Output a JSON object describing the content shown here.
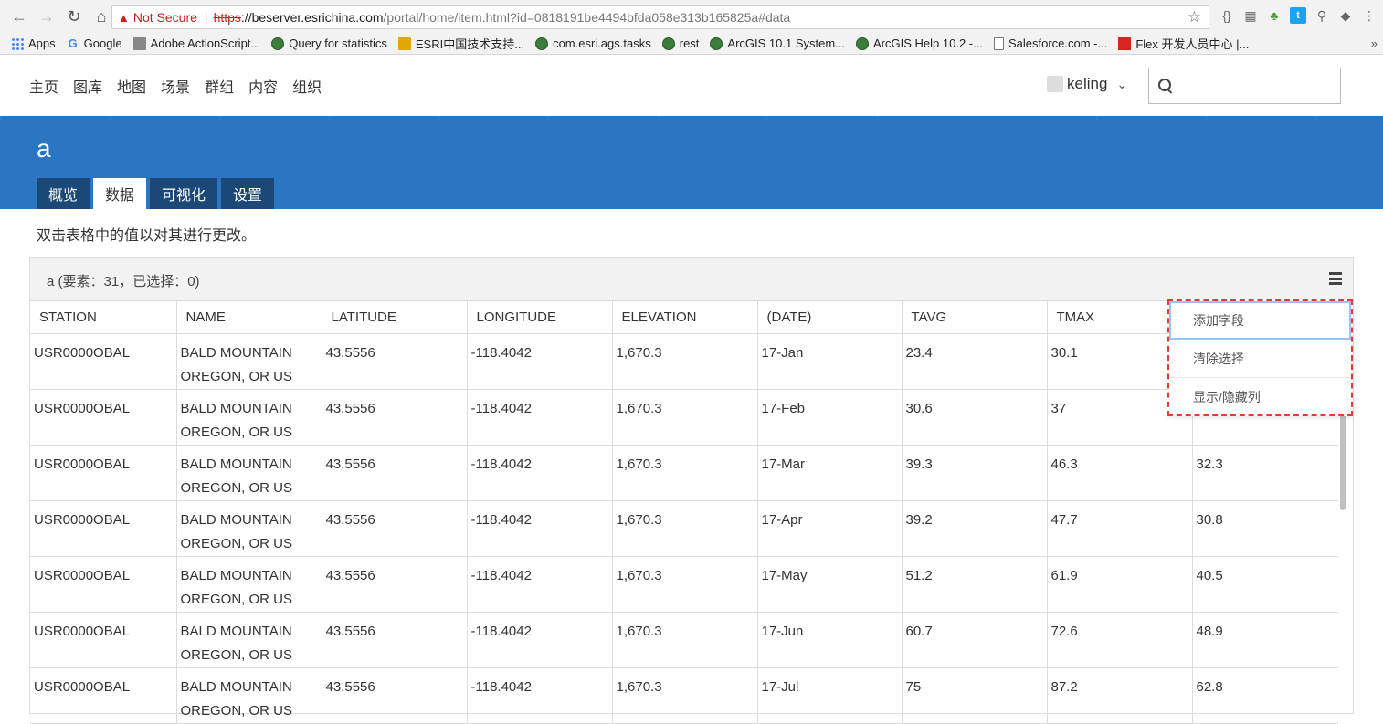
{
  "browser": {
    "not_secure": "Not Secure",
    "url_scheme": "https",
    "url_host": "://beserver.esrichina.com",
    "url_path": "/portal/home/item.html?id=0818191be4494bfda058e313b165825a#data",
    "bookmarks": [
      "Apps",
      "Google",
      "Adobe ActionScript...",
      "Query for statistics",
      "ESRI中国技术支持...",
      "com.esri.ags.tasks",
      "rest",
      "ArcGIS 10.1 System...",
      "ArcGIS Help 10.2 -...",
      "Salesforce.com -...",
      "Flex 开发人员中心 |..."
    ],
    "bookmarks_more": "»"
  },
  "nav": {
    "items": [
      "主页",
      "图库",
      "地图",
      "场景",
      "群组",
      "内容",
      "组织"
    ],
    "username": "keling"
  },
  "search": {
    "placeholder": ""
  },
  "item": {
    "title": "a",
    "tabs": [
      "概览",
      "数据",
      "可视化",
      "设置"
    ],
    "active_tab": "数据",
    "hint": "双击表格中的值以对其进行更改。"
  },
  "table": {
    "title": "a (要素：31，已选择：0)",
    "columns": [
      "STATION",
      "NAME",
      "LATITUDE",
      "LONGITUDE",
      "ELEVATION",
      "(DATE)",
      "TAVG",
      "TMAX",
      ""
    ],
    "rows": [
      [
        "USR0000OBAL",
        "BALD MOUNTAIN OREGON, OR US",
        "43.5556",
        "-118.4042",
        "1,670.3",
        "17-Jan",
        "23.4",
        "30.1",
        ""
      ],
      [
        "USR0000OBAL",
        "BALD MOUNTAIN OREGON, OR US",
        "43.5556",
        "-118.4042",
        "1,670.3",
        "17-Feb",
        "30.6",
        "37",
        ""
      ],
      [
        "USR0000OBAL",
        "BALD MOUNTAIN OREGON, OR US",
        "43.5556",
        "-118.4042",
        "1,670.3",
        "17-Mar",
        "39.3",
        "46.3",
        "32.3"
      ],
      [
        "USR0000OBAL",
        "BALD MOUNTAIN OREGON, OR US",
        "43.5556",
        "-118.4042",
        "1,670.3",
        "17-Apr",
        "39.2",
        "47.7",
        "30.8"
      ],
      [
        "USR0000OBAL",
        "BALD MOUNTAIN OREGON, OR US",
        "43.5556",
        "-118.4042",
        "1,670.3",
        "17-May",
        "51.2",
        "61.9",
        "40.5"
      ],
      [
        "USR0000OBAL",
        "BALD MOUNTAIN OREGON, OR US",
        "43.5556",
        "-118.4042",
        "1,670.3",
        "17-Jun",
        "60.7",
        "72.6",
        "48.9"
      ],
      [
        "USR0000OBAL",
        "BALD MOUNTAIN OREGON, OR US",
        "43.5556",
        "-118.4042",
        "1,670.3",
        "17-Jul",
        "75",
        "87.2",
        "62.8"
      ]
    ]
  },
  "menu": {
    "items": [
      "添加字段",
      "清除选择",
      "显示/隐藏列"
    ]
  }
}
